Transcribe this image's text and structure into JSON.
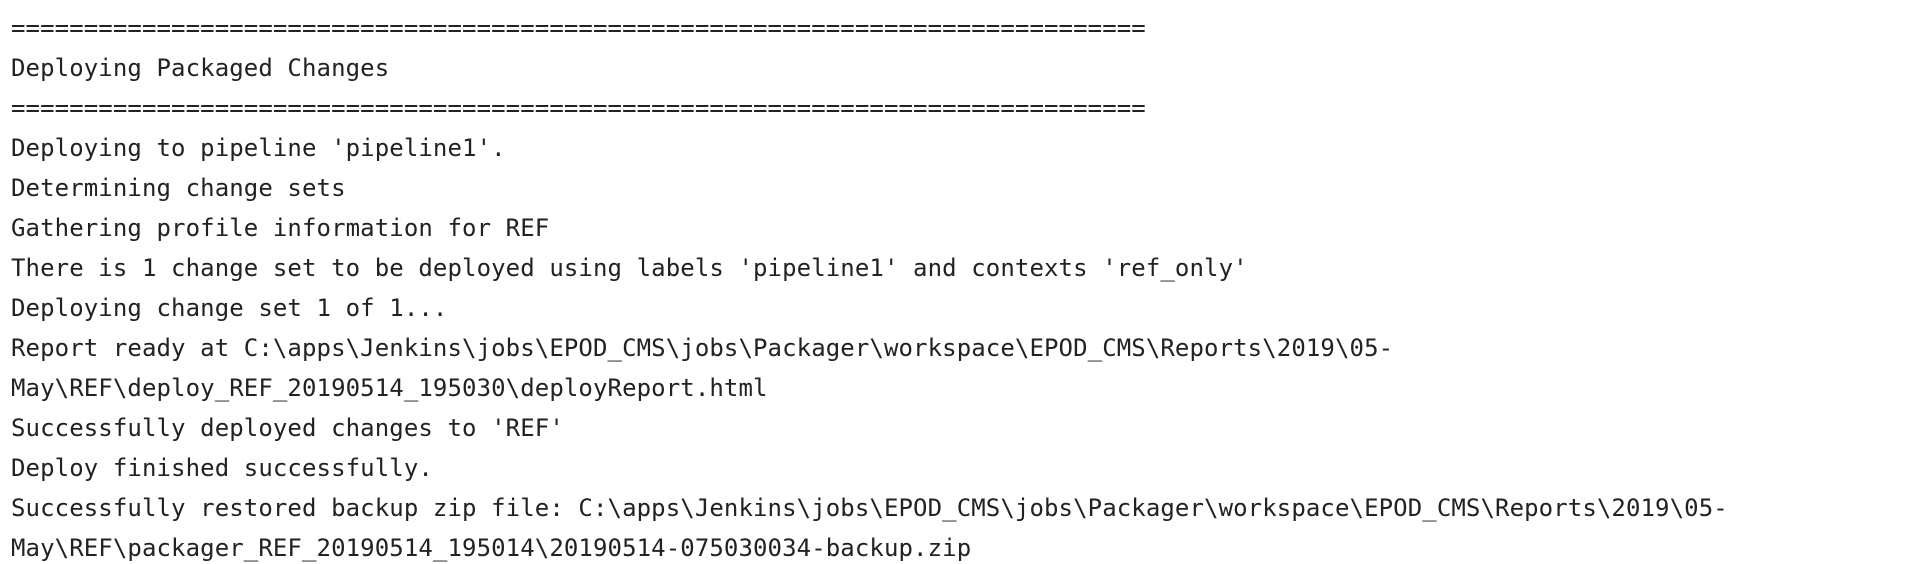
{
  "console": {
    "lines": [
      "==============================================================================",
      "Deploying Packaged Changes",
      "==============================================================================",
      "Deploying to pipeline 'pipeline1'.",
      "Determining change sets",
      "Gathering profile information for REF",
      "There is 1 change set to be deployed using labels 'pipeline1' and contexts 'ref_only'",
      "Deploying change set 1 of 1...",
      "Report ready at C:\\apps\\Jenkins\\jobs\\EPOD_CMS\\jobs\\Packager\\workspace\\EPOD_CMS\\Reports\\2019\\05-",
      "May\\REF\\deploy_REF_20190514_195030\\deployReport.html",
      "Successfully deployed changes to 'REF'",
      "Deploy finished successfully.",
      "Successfully restored backup zip file: C:\\apps\\Jenkins\\jobs\\EPOD_CMS\\jobs\\Packager\\workspace\\EPOD_CMS\\Reports\\2019\\05-",
      "May\\REF\\packager_REF_20190514_195014\\20190514-075030034-backup.zip"
    ]
  }
}
